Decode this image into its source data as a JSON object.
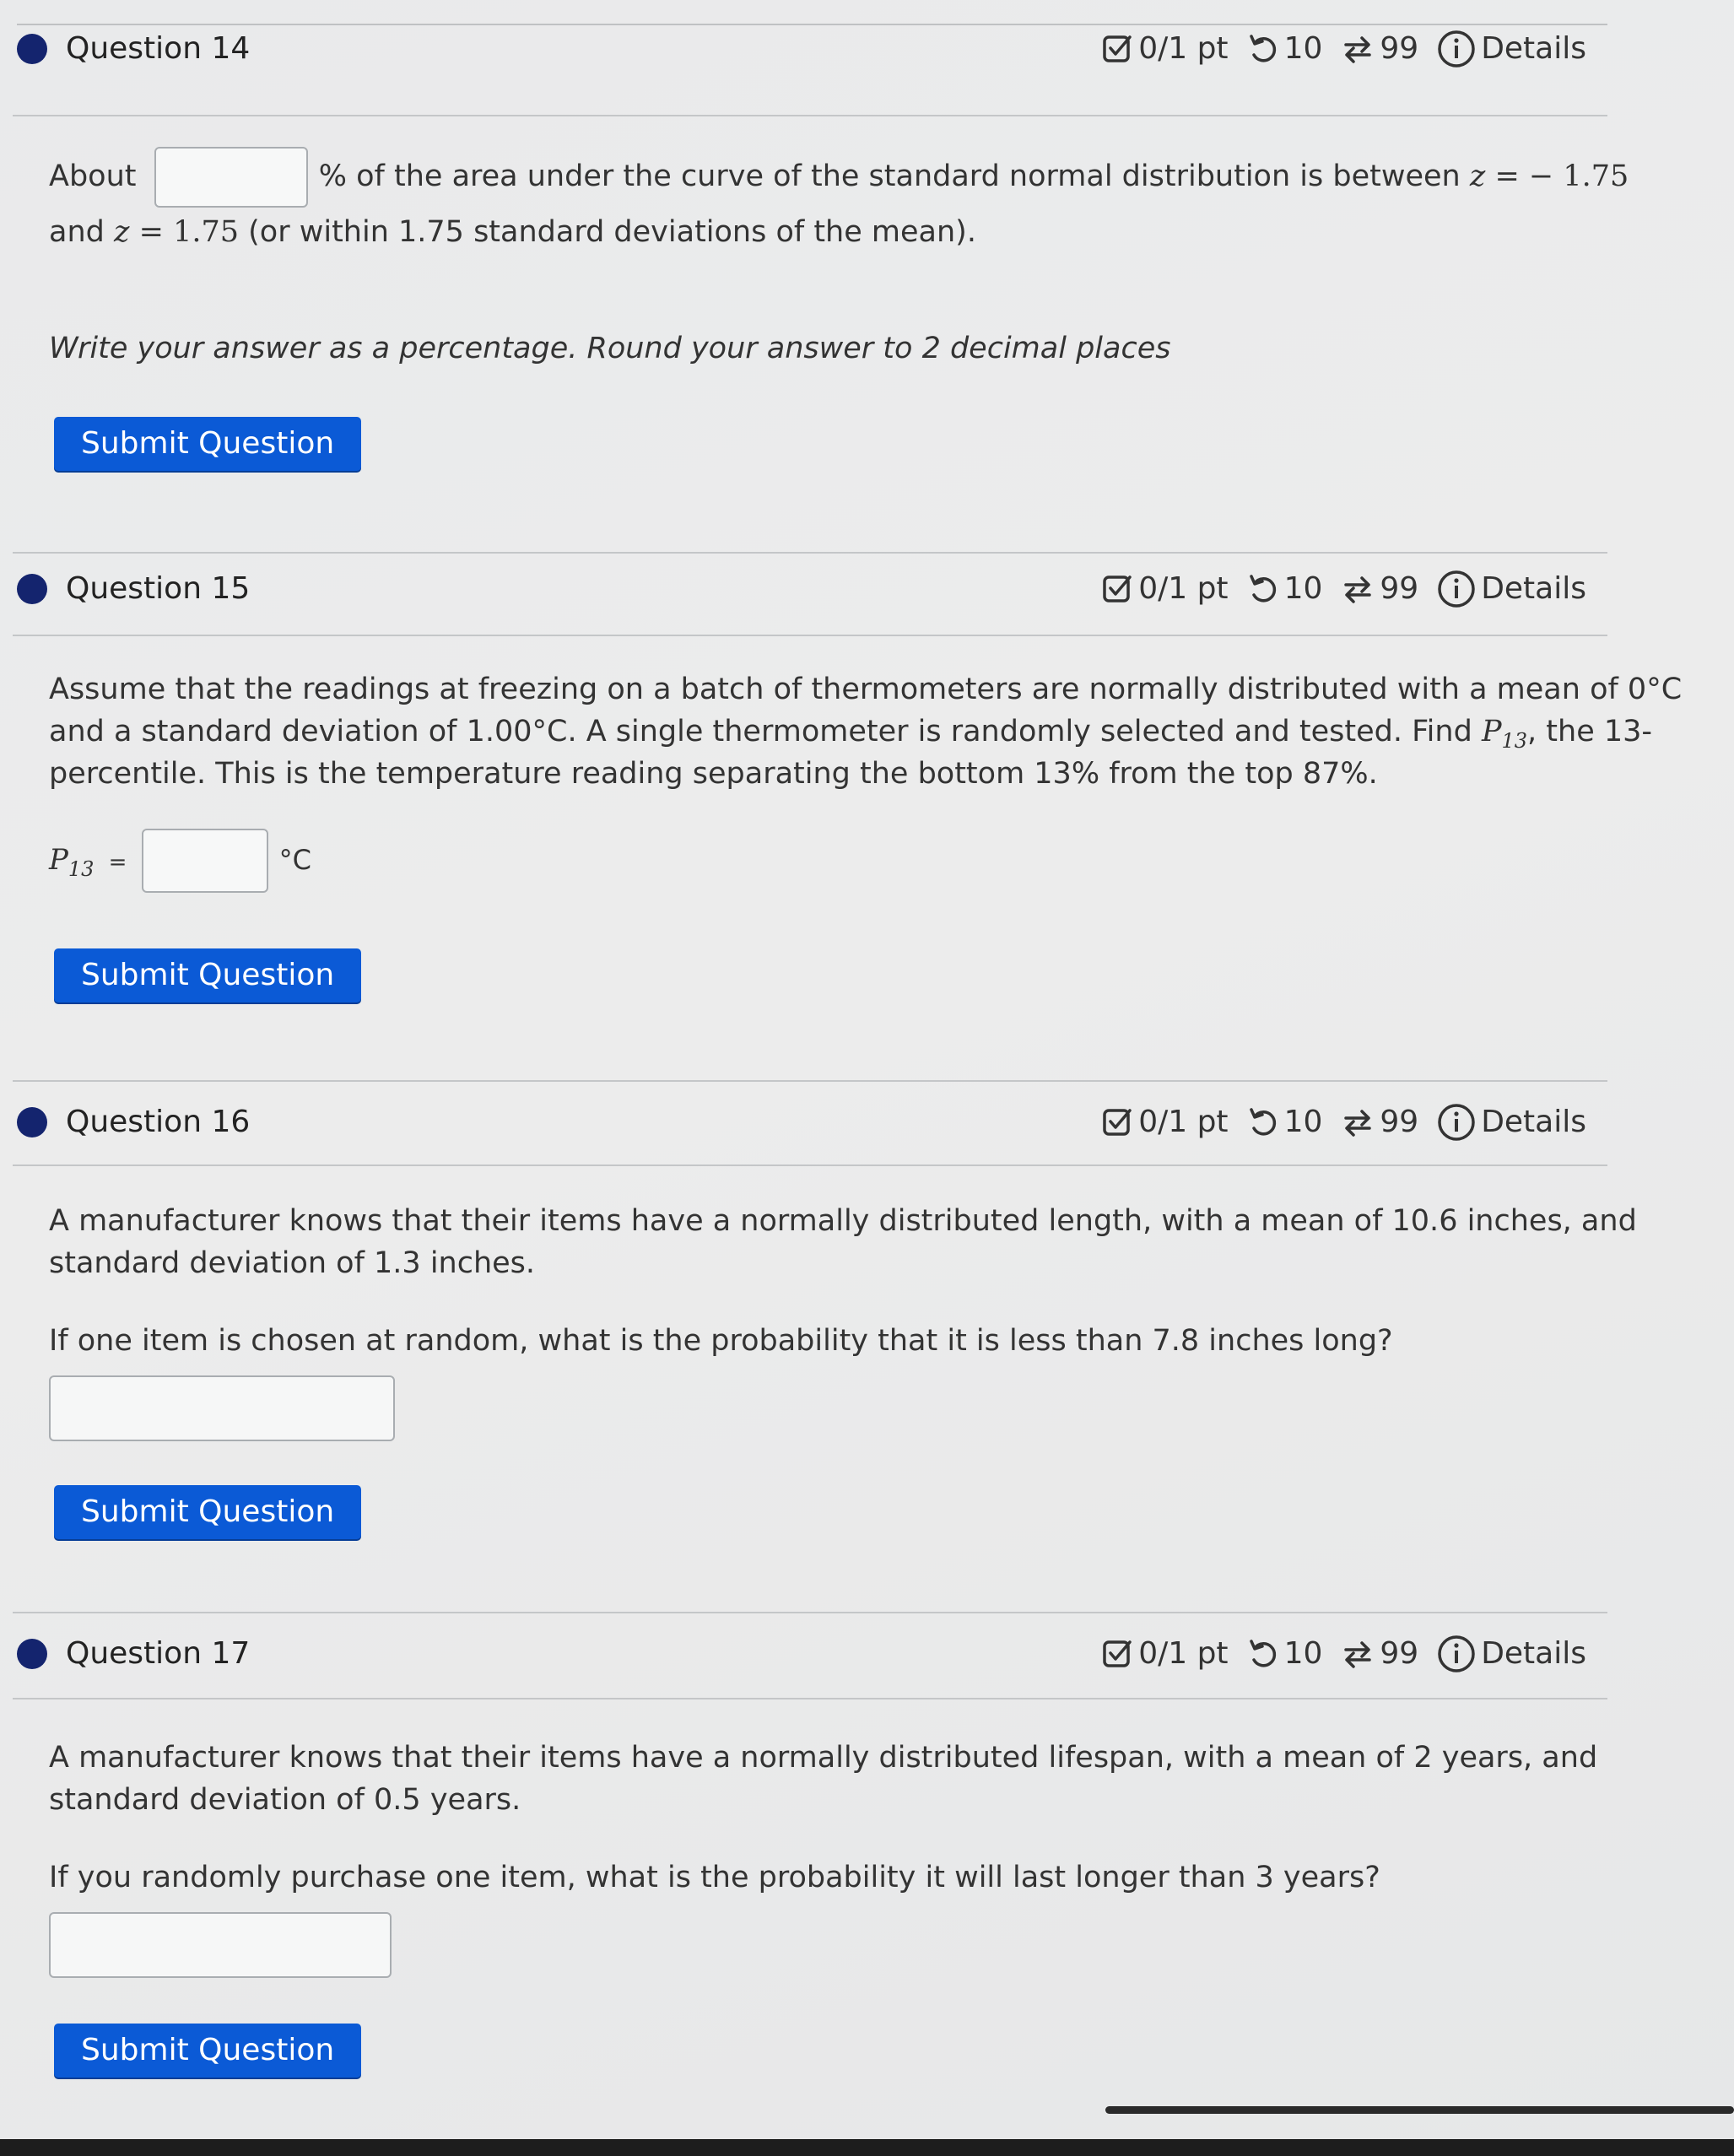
{
  "meta_common": {
    "points": "0/1 pt",
    "attempts": "10",
    "versions": "99",
    "details": "Details"
  },
  "q14": {
    "title": "Question 14",
    "text_before_input": "About",
    "text_after_input": "% of the area under the curve of the standard normal distribution is between",
    "z_var": "z",
    "eq": "=",
    "z_low": "− 1.75",
    "and": "and",
    "z_high": "1.75",
    "tail": "(or within 1.75 standard deviations of the mean).",
    "instruction": "Write your answer as a percentage. Round your answer to 2 decimal places",
    "input_value": "",
    "submit_label": "Submit Question"
  },
  "q15": {
    "title": "Question 15",
    "line1": "Assume that the readings at freezing on a batch of thermometers are normally distributed with a mean of 0°C",
    "line2_a": "and a standard deviation of 1.00°C. A single thermometer is randomly selected and tested. Find",
    "p_symbol": "P",
    "p_sub": "13",
    "line2_b": ", the 13-",
    "line3": "percentile. This is the temperature reading separating the bottom 13% from the top 87%.",
    "answer_label_eq": "=",
    "unit": "°C",
    "input_value": "",
    "submit_label": "Submit Question"
  },
  "q16": {
    "title": "Question 16",
    "line1": "A manufacturer knows that their items have a normally distributed length, with a mean of 10.6 inches, and",
    "line2": "standard deviation of 1.3 inches.",
    "question": "If one item is chosen at random, what is the probability that it is less than 7.8 inches long?",
    "input_value": "",
    "submit_label": "Submit Question"
  },
  "q17": {
    "title": "Question 17",
    "line1": "A manufacturer knows that their items have a normally distributed lifespan, with a mean of 2 years, and",
    "line2": "standard deviation of 0.5 years.",
    "question": "If you randomly purchase one item, what is the probability it will last longer than 3 years?",
    "input_value": "",
    "submit_label": "Submit Question"
  },
  "colors": {
    "accent": "#0b5ad6",
    "status_dot": "#14246e"
  },
  "icons": {
    "points": "checkbox-icon",
    "attempts": "retry-icon",
    "versions": "versions-icon",
    "details": "info-icon"
  }
}
